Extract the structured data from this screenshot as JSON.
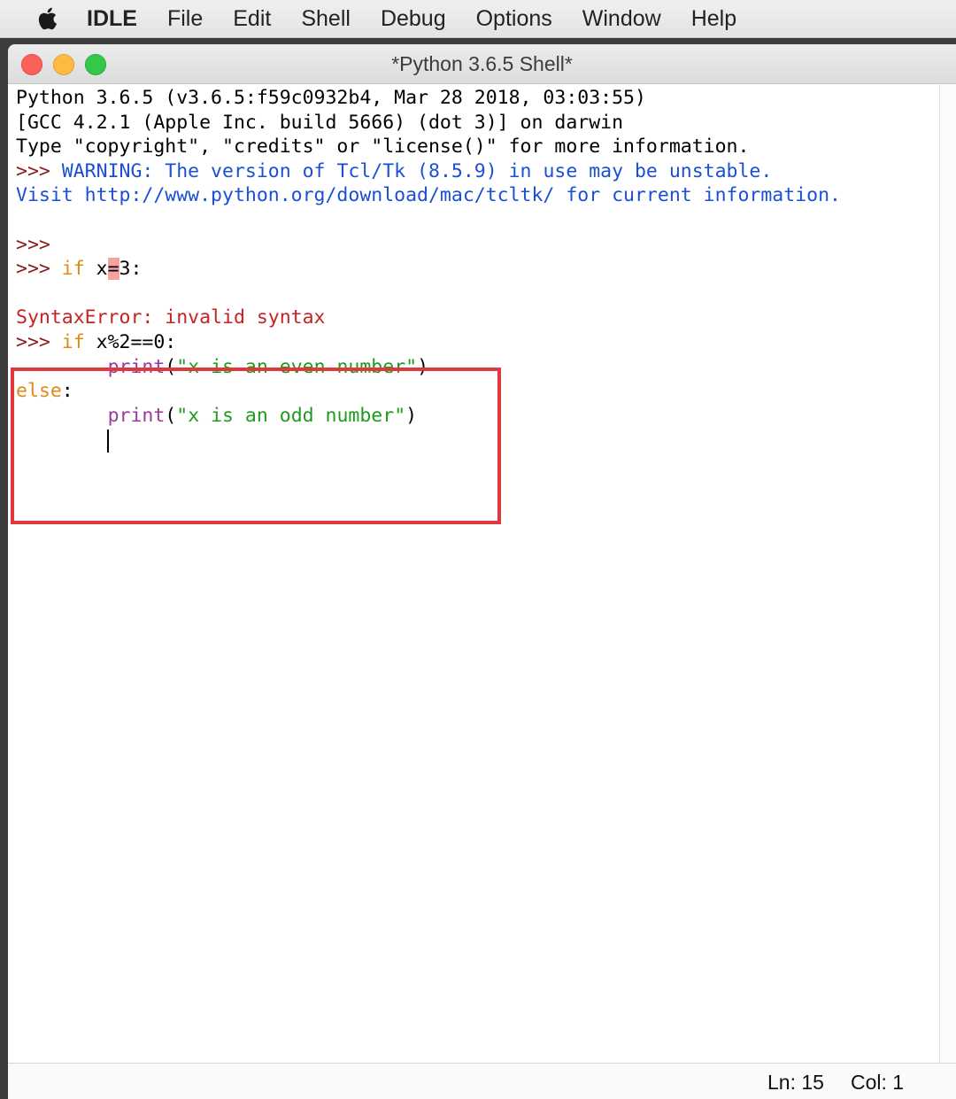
{
  "menubar": {
    "apple_icon": "apple-logo-icon",
    "app_name": "IDLE",
    "items": [
      "File",
      "Edit",
      "Shell",
      "Debug",
      "Options",
      "Window",
      "Help"
    ]
  },
  "window": {
    "title": "*Python 3.6.5 Shell*"
  },
  "shell": {
    "banner1": "Python 3.6.5 (v3.6.5:f59c0932b4, Mar 28 2018, 03:03:55)",
    "banner2": "[GCC 4.2.1 (Apple Inc. build 5666) (dot 3)] on darwin",
    "banner3": "Type \"copyright\", \"credits\" or \"license()\" for more information.",
    "prompt": ">>>",
    "warning1": " WARNING: The version of Tcl/Tk (8.5.9) in use may be unstable.",
    "warning2": "Visit http://www.python.org/download/mac/tcltk/ for current information.",
    "cmd1_keyword": "if",
    "cmd1_x": "x",
    "cmd1_eq": "=",
    "cmd1_rest": "3:",
    "error": "SyntaxError: invalid syntax",
    "cmd2_keyword": "if",
    "cmd2_rest": "x%2==0:",
    "print_kw": "print",
    "paren_open": "(",
    "paren_close": ")",
    "even_str": "\"x is an even number\"",
    "else_kw": "else",
    "colon": ":",
    "odd_str": "\"x is an odd number\""
  },
  "status": {
    "ln": "Ln: 15",
    "col": "Col: 1"
  },
  "colors": {
    "output": "#1a4fd6",
    "error": "#c62222",
    "keyword": "#e08a16",
    "builtin": "#9a3a9a",
    "string": "#1f9b1f",
    "annotation_box": "#e0393d"
  }
}
